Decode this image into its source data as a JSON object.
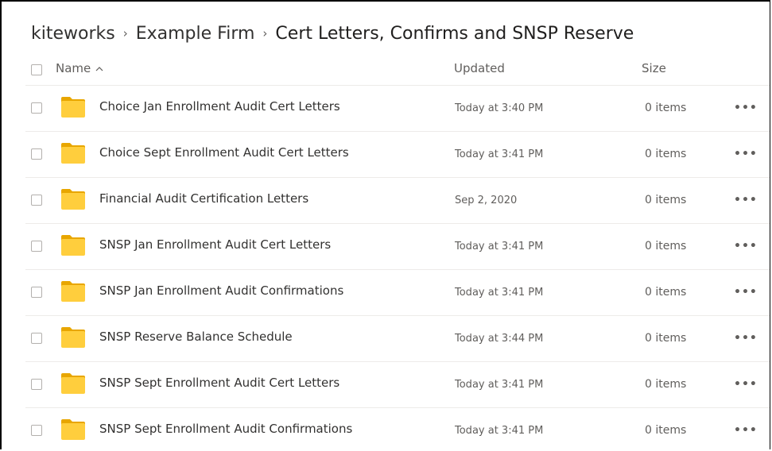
{
  "breadcrumb": {
    "items": [
      "kiteworks",
      "Example Firm",
      "Cert Letters, Confirms and SNSP Reserve"
    ],
    "separator": "›"
  },
  "table": {
    "headers": {
      "name": "Name",
      "updated": "Updated",
      "size": "Size"
    },
    "sort_icon": "chevron-up-icon",
    "rows": [
      {
        "name": "Choice Jan Enrollment Audit Cert Letters",
        "updated": "Today at 3:40 PM",
        "size": "0 items"
      },
      {
        "name": "Choice Sept Enrollment Audit Cert Letters",
        "updated": "Today at 3:41 PM",
        "size": "0 items"
      },
      {
        "name": "Financial Audit Certification Letters",
        "updated": "Sep 2, 2020",
        "size": "0 items"
      },
      {
        "name": "SNSP Jan Enrollment Audit Cert Letters",
        "updated": "Today at 3:41 PM",
        "size": "0 items"
      },
      {
        "name": "SNSP Jan Enrollment Audit Confirmations",
        "updated": "Today at 3:41 PM",
        "size": "0 items"
      },
      {
        "name": "SNSP Reserve Balance Schedule",
        "updated": "Today at 3:44 PM",
        "size": "0 items"
      },
      {
        "name": "SNSP Sept Enrollment Audit Cert Letters",
        "updated": "Today at 3:41 PM",
        "size": "0 items"
      },
      {
        "name": "SNSP Sept Enrollment Audit Confirmations",
        "updated": "Today at 3:41 PM",
        "size": "0 items"
      }
    ],
    "more_label": "•••"
  },
  "colors": {
    "folder_body": "#FFCE3D",
    "folder_tab": "#E8A600",
    "divider": "#EDEBE9",
    "text": "#323130",
    "muted_text": "#605E5C"
  }
}
